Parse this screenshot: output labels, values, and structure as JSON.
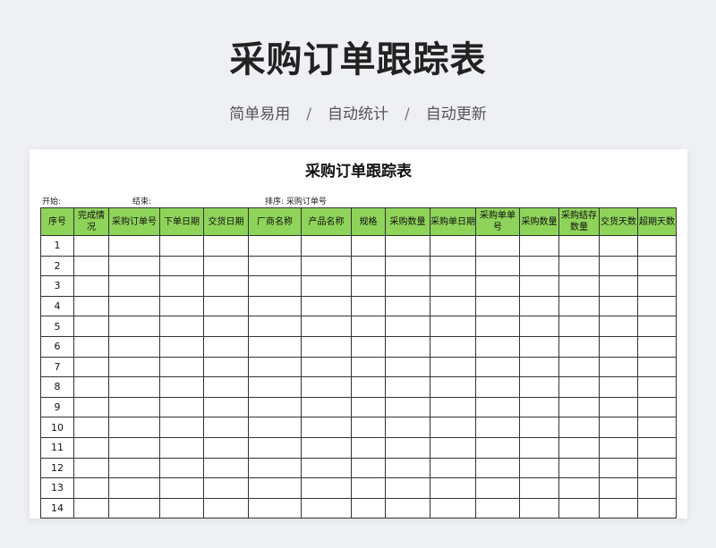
{
  "page": {
    "title": "采购订单跟踪表",
    "tags": [
      "简单易用",
      "自动统计",
      "自动更新"
    ],
    "separator": "/"
  },
  "sheet": {
    "title": "采购订单跟踪表",
    "start_label": "开始:",
    "end_label": "结束:",
    "sort_label": "排序:",
    "sort_value": "采购订单号",
    "columns": [
      "序号",
      "完成情况",
      "采购订单号",
      "下单日期",
      "交货日期",
      "厂商名称",
      "产品名称",
      "规格",
      "采购数量",
      "采购单日期",
      "采购单单号",
      "采购数量",
      "采购结存数量",
      "交货天数",
      "超期天数"
    ],
    "rows": [
      "1",
      "2",
      "3",
      "4",
      "5",
      "6",
      "7",
      "8",
      "9",
      "10",
      "11",
      "12",
      "13",
      "14"
    ]
  }
}
